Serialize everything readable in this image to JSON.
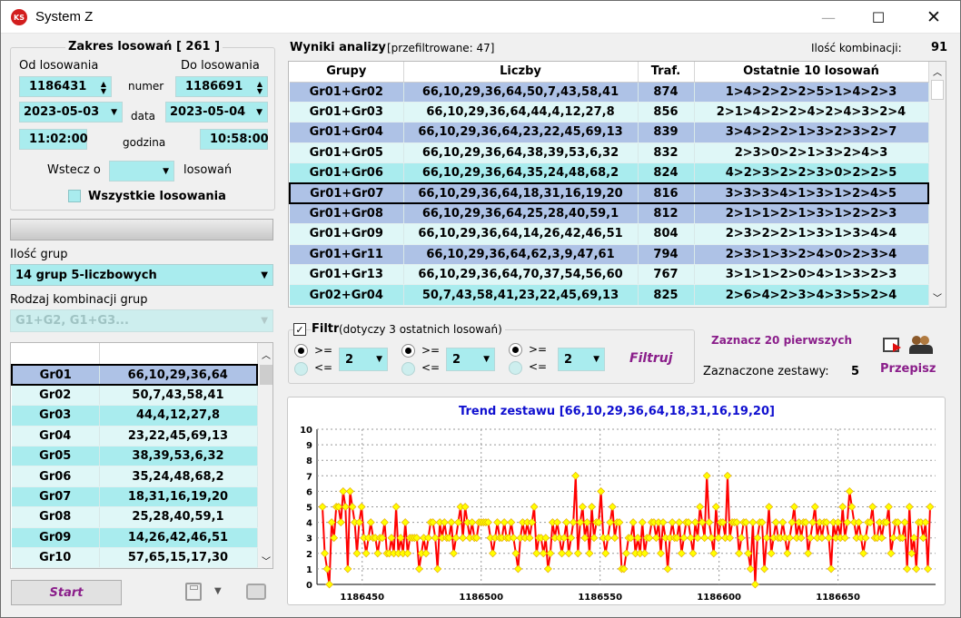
{
  "window": {
    "title": "System Z",
    "app_icon_text": "KS",
    "minimize": "—",
    "maximize": "☐",
    "close": "✕"
  },
  "range": {
    "title": "Zakres losowań  [ 261 ]",
    "from_label": "Od losowania",
    "to_label": "Do losowania",
    "from_number": "1186431",
    "to_number": "1186691",
    "number_label": "numer",
    "from_date": "2023-05-03",
    "to_date": "2023-05-04",
    "date_label": "data",
    "from_time": "11:02:00",
    "to_time": "10:58:00",
    "time_label": "godzina",
    "back_label": "Wstecz o",
    "back_value": "",
    "back_suffix": "losowań",
    "all_label": "Wszystkie losowania"
  },
  "left": {
    "groups_label": "Ilość grup",
    "groups_value": "14 grup 5-liczbowych",
    "combo_label": "Rodzaj kombinacji grup",
    "combo_value": "G1+G2, G1+G3...",
    "groups_rows": [
      [
        "Gr01",
        "66,10,29,36,64"
      ],
      [
        "Gr02",
        "50,7,43,58,41"
      ],
      [
        "Gr03",
        "44,4,12,27,8"
      ],
      [
        "Gr04",
        "23,22,45,69,13"
      ],
      [
        "Gr05",
        "38,39,53,6,32"
      ],
      [
        "Gr06",
        "35,24,48,68,2"
      ],
      [
        "Gr07",
        "18,31,16,19,20"
      ],
      [
        "Gr08",
        "25,28,40,59,1"
      ],
      [
        "Gr09",
        "14,26,42,46,51"
      ],
      [
        "Gr10",
        "57,65,15,17,30"
      ]
    ],
    "start_label": "Start"
  },
  "results": {
    "title": "Wyniki analizy",
    "filtered": "[przefiltrowane: 47]",
    "count_label": "Ilość kombinacji:",
    "count_value": "91",
    "headers": [
      "Grupy",
      "Liczby",
      "Traf.",
      "Ostatnie 10 losowań"
    ],
    "rows": [
      [
        "Gr01+Gr02",
        "66,10,29,36,64,50,7,43,58,41",
        "874",
        "1>4>2>2>2>5>1>4>2>3"
      ],
      [
        "Gr01+Gr03",
        "66,10,29,36,64,44,4,12,27,8",
        "856",
        "2>1>4>2>2>4>2>4>3>2>4"
      ],
      [
        "Gr01+Gr04",
        "66,10,29,36,64,23,22,45,69,13",
        "839",
        "3>4>2>2>1>3>2>3>2>7"
      ],
      [
        "Gr01+Gr05",
        "66,10,29,36,64,38,39,53,6,32",
        "832",
        "2>3>0>2>1>3>2>4>3"
      ],
      [
        "Gr01+Gr06",
        "66,10,29,36,64,35,24,48,68,2",
        "824",
        "4>2>3>2>2>3>0>2>2>5"
      ],
      [
        "Gr01+Gr07",
        "66,10,29,36,64,18,31,16,19,20",
        "816",
        "3>3>3>4>1>3>1>2>4>5"
      ],
      [
        "Gr01+Gr08",
        "66,10,29,36,64,25,28,40,59,1",
        "812",
        "2>1>1>2>1>3>1>2>2>3"
      ],
      [
        "Gr01+Gr09",
        "66,10,29,36,64,14,26,42,46,51",
        "804",
        "2>3>2>2>1>3>1>3>4>4"
      ],
      [
        "Gr01+Gr11",
        "66,10,29,36,64,62,3,9,47,61",
        "794",
        "2>3>1>3>2>4>0>2>3>4"
      ],
      [
        "Gr01+Gr13",
        "66,10,29,36,64,70,37,54,56,60",
        "767",
        "3>1>1>2>0>4>1>3>2>3"
      ],
      [
        "Gr02+Gr04",
        "50,7,43,58,41,23,22,45,69,13",
        "825",
        "2>6>4>2>3>4>3>5>2>4"
      ]
    ]
  },
  "filter": {
    "label": "Filtr",
    "note": "(dotyczy 3 ostatnich losowań)",
    "ge": ">=",
    "le": "<=",
    "v1": "2",
    "v2": "2",
    "v3": "2",
    "apply": "Filtruj",
    "mark20": "Zaznacz 20 pierwszych",
    "marked_label": "Zaznaczone zestawy:",
    "marked_value": "5",
    "copy": "Przepisz"
  },
  "colors": {
    "accent": "#8a1e8a",
    "chart_title": "#1010d0",
    "line": "#ff0000",
    "marker": "#ffff00"
  },
  "chart_data": {
    "type": "line",
    "title": "Trend zestawu [66,10,29,36,64,18,31,16,19,20]",
    "xlabel": "",
    "ylabel": "",
    "ylim": [
      0,
      10
    ],
    "yticks": [
      0,
      1,
      2,
      3,
      4,
      5,
      6,
      7,
      8,
      9,
      10
    ],
    "xticks": [
      1186450,
      1186500,
      1186550,
      1186600,
      1186650
    ],
    "xlim": [
      1186431,
      1186691
    ],
    "grid": true,
    "series": [
      {
        "values": [
          5,
          2,
          1,
          0,
          4,
          3,
          5,
          5,
          4,
          6,
          5,
          1,
          6,
          5,
          4,
          2,
          4,
          5,
          3,
          2,
          3,
          4,
          3,
          3,
          2,
          3,
          3,
          4,
          2,
          2,
          3,
          2,
          5,
          2,
          3,
          2,
          4,
          2,
          3,
          3,
          3,
          3,
          1,
          2,
          3,
          2,
          3,
          4,
          4,
          3,
          1,
          4,
          3,
          4,
          3,
          3,
          4,
          2,
          3,
          4,
          5,
          3,
          5,
          4,
          3,
          4,
          3,
          3,
          4,
          4,
          4,
          4,
          4,
          3,
          2,
          3,
          4,
          3,
          3,
          4,
          3,
          3,
          4,
          3,
          2,
          1,
          3,
          4,
          3,
          4,
          3,
          4,
          5,
          2,
          3,
          3,
          2,
          3,
          1,
          2,
          4,
          3,
          4,
          3,
          2,
          3,
          4,
          2,
          3,
          4,
          7,
          2,
          4,
          5,
          3,
          4,
          2,
          5,
          3,
          4,
          4,
          6,
          3,
          2,
          3,
          4,
          5,
          3,
          4,
          4,
          1,
          1,
          2,
          3,
          3,
          4,
          2,
          3,
          2,
          4,
          2,
          3,
          3,
          4,
          4,
          3,
          4,
          2,
          4,
          3,
          1,
          3,
          4,
          3,
          3,
          4,
          2,
          3,
          4,
          4,
          3,
          2,
          4,
          3,
          5,
          4,
          3,
          7,
          4,
          3,
          2,
          5,
          3,
          4,
          4,
          3,
          7,
          3,
          4,
          4,
          4,
          2,
          3,
          4,
          4,
          2,
          1,
          4,
          0,
          3,
          4,
          4,
          1,
          3,
          5,
          2,
          3,
          4,
          3,
          3,
          4,
          3,
          2,
          3,
          4,
          5,
          3,
          4,
          3,
          4,
          4,
          2,
          3,
          4,
          5,
          3,
          4,
          3,
          4,
          4,
          3,
          1,
          4,
          3,
          4,
          3,
          5,
          3,
          4,
          6,
          5,
          4,
          3,
          4,
          3,
          2,
          3,
          4,
          4,
          5,
          3,
          3,
          4,
          3,
          4,
          4,
          5,
          2,
          3,
          4,
          4,
          3,
          3,
          4,
          1,
          5,
          2,
          3,
          1,
          4,
          4,
          3,
          4,
          1,
          5
        ]
      }
    ]
  }
}
